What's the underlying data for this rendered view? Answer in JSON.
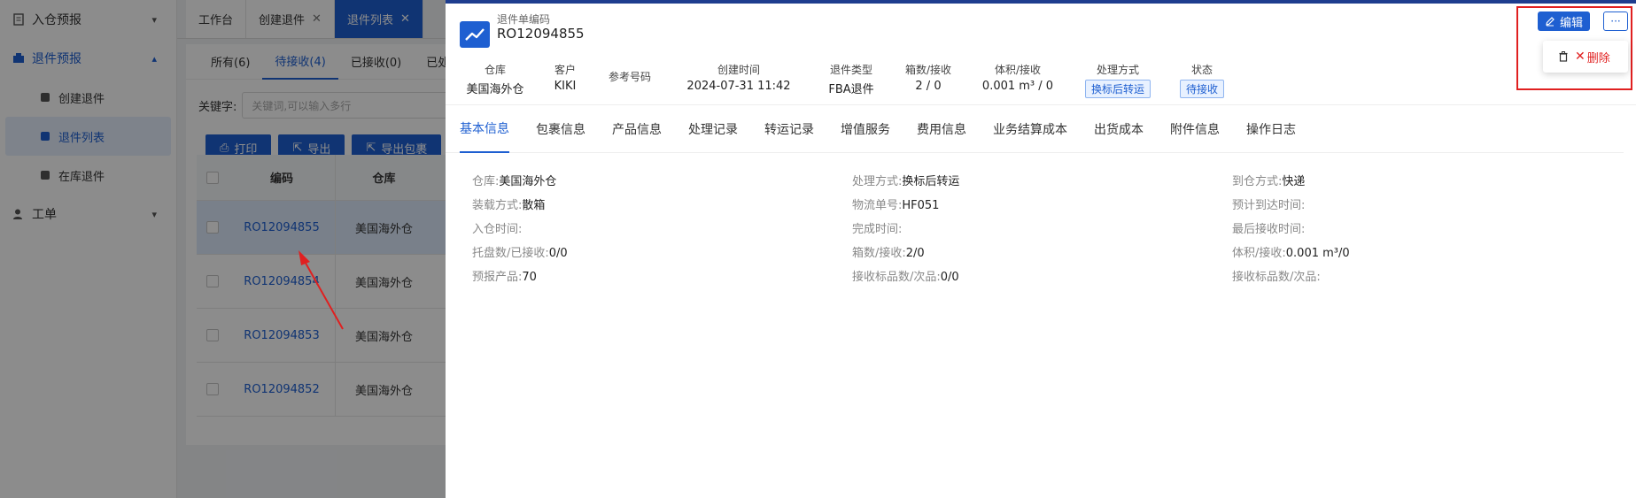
{
  "sidebar": {
    "groups": [
      {
        "label": "入仓预报",
        "chevron": "⌄",
        "active": false
      },
      {
        "label": "退件预报",
        "chevron": "⌃",
        "active": true
      },
      {
        "label": "工单",
        "chevron": "⌄",
        "active": false
      }
    ],
    "items": [
      {
        "label": "创建退件"
      },
      {
        "label": "退件列表",
        "selected": true
      },
      {
        "label": "在库退件"
      }
    ]
  },
  "tabbar": {
    "tabs": [
      {
        "label": "工作台",
        "closable": false
      },
      {
        "label": "创建退件",
        "closable": true
      },
      {
        "label": "退件列表",
        "closable": true,
        "active": true
      }
    ]
  },
  "list": {
    "status_tabs": [
      "所有(6)",
      "待接收(4)",
      "已接收(0)",
      "已处"
    ],
    "keyword_label": "关键字:",
    "keyword_placeholder": "关键词,可以输入多行",
    "buttons": [
      "打印",
      "导出",
      "导出包裹"
    ],
    "columns": [
      "编码",
      "仓库"
    ],
    "rows": [
      {
        "code": "RO12094855",
        "warehouse": "美国海外仓"
      },
      {
        "code": "RO12094854",
        "warehouse": "美国海外仓"
      },
      {
        "code": "RO12094853",
        "warehouse": "美国海外仓"
      },
      {
        "code": "RO12094852",
        "warehouse": "美国海外仓"
      }
    ]
  },
  "drawer": {
    "order_label": "退件单编码",
    "order_code": "RO12094855",
    "summary": [
      {
        "key": "仓库",
        "value": "美国海外仓"
      },
      {
        "key": "客户",
        "value": "KIKI"
      },
      {
        "key": "参考号码",
        "value": ""
      },
      {
        "key": "创建时间",
        "value": "2024-07-31 11:42"
      },
      {
        "key": "退件类型",
        "value": "FBA退件"
      },
      {
        "key": "箱数/接收",
        "value": "2 / 0"
      },
      {
        "key": "体积/接收",
        "value": "0.001 m³ / 0"
      },
      {
        "key": "处理方式",
        "value": "换标后转运",
        "tag": true
      },
      {
        "key": "状态",
        "value": "待接收",
        "tag": true
      }
    ],
    "actions": {
      "edit_label": "编辑",
      "more_label": "···",
      "delete_label": "删除"
    },
    "tabs": [
      "基本信息",
      "包裹信息",
      "产品信息",
      "处理记录",
      "转运记录",
      "增值服务",
      "费用信息",
      "业务结算成本",
      "出货成本",
      "附件信息",
      "操作日志"
    ],
    "info": [
      {
        "label": "仓库:",
        "value": "美国海外仓"
      },
      {
        "label": "处理方式:",
        "value": "换标后转运"
      },
      {
        "label": "到仓方式:",
        "value": "快递"
      },
      {
        "label": "装载方式:",
        "value": "散箱"
      },
      {
        "label": "物流单号:",
        "value": "HF051"
      },
      {
        "label": "预计到达时间:",
        "value": ""
      },
      {
        "label": "入仓时间:",
        "value": ""
      },
      {
        "label": "完成时间:",
        "value": ""
      },
      {
        "label": "最后接收时间:",
        "value": ""
      },
      {
        "label": "托盘数/已接收:",
        "value": "0/0"
      },
      {
        "label": "箱数/接收:",
        "value": "2/0"
      },
      {
        "label": "体积/接收:",
        "value": "0.001 m³/0"
      },
      {
        "label": "预报产品:",
        "value": "70"
      },
      {
        "label": "接收标品数/次品:",
        "value": "0/0"
      },
      {
        "label": "接收标品数/次品:",
        "value": ""
      }
    ]
  },
  "colors": {
    "primary": "#1e5fd1",
    "danger": "#e02020",
    "header_border": "#1e3d8f"
  }
}
